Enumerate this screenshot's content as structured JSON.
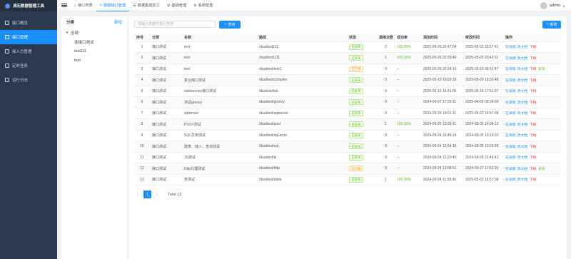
{
  "app": {
    "title": "流石数据管理工具"
  },
  "sidebar": {
    "items": [
      {
        "label": "接口概览",
        "active": false
      },
      {
        "label": "接口管理",
        "active": true
      },
      {
        "label": "接入方管理",
        "active": false
      },
      {
        "label": "定时任务",
        "active": false
      },
      {
        "label": "运行日志",
        "active": false
      }
    ]
  },
  "topbar": {
    "tabs": [
      {
        "label": "接口列表",
        "icon": "search-icon",
        "active": false
      },
      {
        "label": "数据接口管理",
        "icon": "link-icon",
        "active": true
      },
      {
        "label": "数据集成加工",
        "icon": "list-icon",
        "active": false
      },
      {
        "label": "基础管理",
        "icon": "gear-icon",
        "active": false
      },
      {
        "label": "系统配置",
        "icon": "gear-icon",
        "active": false
      }
    ],
    "user": "admin"
  },
  "tree": {
    "title": "分类",
    "add_label": "新增",
    "root": "全部",
    "children": [
      "连接口测试",
      "test111",
      "test"
    ]
  },
  "toolbar": {
    "search_placeholder": "请输入关键字进行查询",
    "query_label": "查询",
    "add_label": "新增"
  },
  "table": {
    "headers": [
      "序号",
      "分类",
      "名称",
      "路径",
      "状态",
      "调用次数",
      "成功率",
      "添加时间",
      "修改时间",
      "操作"
    ],
    "rows": [
      {
        "no": "1",
        "category": "接口测试",
        "name": "test",
        "path": "/dua/test111",
        "status": "已发布",
        "published": true,
        "calls": "2",
        "rate": "100.00%",
        "created": "2025-05-20 20:47:04",
        "updated": "2025-05-22 16:57:41",
        "ops": [
          "在详情",
          "改文档",
          "下线"
        ]
      },
      {
        "no": "2",
        "category": "接口测试",
        "name": "test",
        "path": "/dua/test1111",
        "status": "已发布",
        "published": true,
        "calls": "1",
        "rate": "100.00%",
        "created": "2025-05-20 20:39:40",
        "updated": "2025-05-20 20:42:11",
        "ops": [
          "在详情",
          "改文档",
          "下线"
        ]
      },
      {
        "no": "3",
        "category": "接口测试",
        "name": "test",
        "path": "/dua/test/test1",
        "status": "已下线",
        "published": false,
        "calls": "0",
        "rate": "--",
        "created": "2025-05-20 20:24:16",
        "updated": "2025-05-23 09:31:47",
        "ops": [
          "在详情",
          "改文档",
          "下线",
          "发布"
        ]
      },
      {
        "no": "4",
        "category": "接口测试",
        "name": "复合接口测试",
        "path": "/dua/test/complex",
        "status": "已发布",
        "published": true,
        "calls": "0",
        "rate": "--",
        "created": "2025-05-19 19:59:18",
        "updated": "2025-05-20 19:30:48",
        "ops": [
          "在详情",
          "改文档",
          "下线"
        ]
      },
      {
        "no": "5",
        "category": "接口测试",
        "name": "webservice接口测试",
        "path": "/dua/ws/test",
        "status": "已发布",
        "published": true,
        "calls": "0",
        "rate": "--",
        "created": "2025-05-16 16:41:05",
        "updated": "2025-05-16 17:51:37",
        "ops": [
          "在详情",
          "改文档",
          "下线"
        ]
      },
      {
        "no": "6",
        "category": "接口测试",
        "name": "测试groovy",
        "path": "/dua/test/groovy",
        "status": "已发布",
        "published": true,
        "calls": "0",
        "rate": "--",
        "created": "2024-09-27 17:29:11",
        "updated": "2025-04-09 08:34:04",
        "ops": [
          "在详情",
          "改文档",
          "下线"
        ]
      },
      {
        "no": "7",
        "category": "接口测试",
        "name": "sqlserver",
        "path": "/dua/test/sqlserver",
        "status": "已发布",
        "published": true,
        "calls": "0",
        "rate": "--",
        "created": "2024-09-26 19:01:11",
        "updated": "2025-05-22 16:57:39",
        "ops": [
          "在详情",
          "改文档",
          "下线"
        ]
      },
      {
        "no": "8",
        "category": "接口测试",
        "name": "POST测试",
        "path": "/dua/test/post",
        "status": "已发布",
        "published": true,
        "calls": "1",
        "rate": "100.00%",
        "created": "2024-09-25 13:29:11",
        "updated": "2024-09-25 14:08:12",
        "ops": [
          "在详情",
          "改文档",
          "下线"
        ]
      },
      {
        "no": "9",
        "category": "接口测试",
        "name": "SQL异常测试",
        "path": "/dua/test/sql-error",
        "status": "已发布",
        "published": true,
        "calls": "0",
        "rate": "--",
        "created": "2024-09-24 16:46:14",
        "updated": "2024-09-25 13:19:10",
        "ops": [
          "在详情",
          "改文档",
          "下线"
        ]
      },
      {
        "no": "10",
        "category": "接口测试",
        "name": "建表、插入、查询测试",
        "path": "/dua/test/sql",
        "status": "已发布",
        "published": true,
        "calls": "0",
        "rate": "--",
        "created": "2024-09-24 12:54:19",
        "updated": "2024-09-25 13:29:26",
        "ops": [
          "在详情",
          "改文档",
          "下线"
        ]
      },
      {
        "no": "11",
        "category": "接口测试",
        "name": "JS测试",
        "path": "/dua/test/js",
        "status": "已发布",
        "published": true,
        "calls": "0",
        "rate": "--",
        "created": "2024-09-24 12:20:40",
        "updated": "2024-09-25 21:46:41",
        "ops": [
          "在详情",
          "改文档",
          "下线"
        ]
      },
      {
        "no": "12",
        "category": "接口测试",
        "name": "Http代理测试",
        "path": "/dua/test/http",
        "status": "已下线",
        "published": false,
        "calls": "0",
        "rate": "--",
        "created": "2024-09-24 12:08:51",
        "updated": "2024-09-27 17:52:20",
        "ops": [
          "在详情",
          "改文档",
          "下线",
          "发布"
        ]
      },
      {
        "no": "13",
        "category": "接口测试",
        "name": "表测试",
        "path": "/dua/test/table",
        "status": "已发布",
        "published": true,
        "calls": "1",
        "rate": "100.00%",
        "created": "2024-09-24 11:58:36",
        "updated": "2025-05-22 16:57:38",
        "ops": [
          "在详情",
          "改文档",
          "下线"
        ]
      }
    ]
  },
  "pagination": {
    "current": "1",
    "total_label": "Total 13"
  }
}
